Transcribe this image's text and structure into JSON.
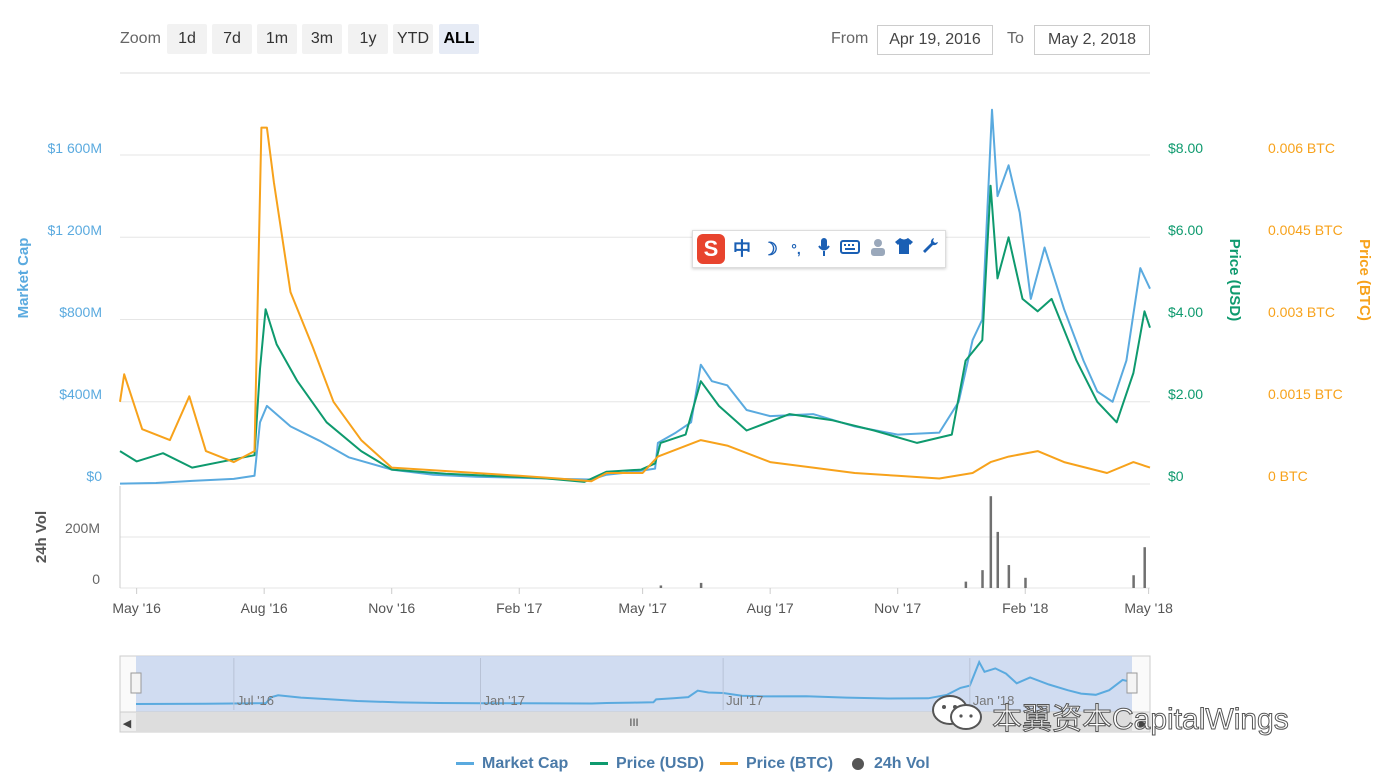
{
  "toolbar": {
    "zoom_label": "Zoom",
    "buttons": [
      "1d",
      "7d",
      "1m",
      "3m",
      "1y",
      "YTD",
      "ALL"
    ],
    "active": "ALL",
    "from_label": "From",
    "from_value": "Apr 19, 2016",
    "to_label": "To",
    "to_value": "May 2, 2018"
  },
  "colors": {
    "market_cap": "#5aaadf",
    "price_usd": "#0e9a6e",
    "price_btc": "#f7a21b",
    "volume": "#707070",
    "navigator_fill": "#c8d6ee"
  },
  "ime_toolbar": {
    "brand": "S",
    "items": [
      "中",
      "☽",
      "°,",
      "mic-icon",
      "keyboard-icon",
      "user-icon",
      "shirt-icon",
      "wrench-icon"
    ]
  },
  "watermark": {
    "text": "本翼资本CapitalWings"
  },
  "legend": {
    "items": [
      "Market Cap",
      "Price (USD)",
      "Price (BTC)",
      "24h Vol"
    ]
  },
  "chart_data": {
    "type": "line",
    "axes": {
      "market_cap": {
        "label": "Market Cap",
        "ticks": [
          "$0",
          "$400M",
          "$800M",
          "$1 200M",
          "$1 600M"
        ],
        "range": [
          0,
          1600
        ]
      },
      "price_usd": {
        "label": "Price (USD)",
        "ticks": [
          "$0",
          "$2.00",
          "$4.00",
          "$6.00",
          "$8.00"
        ],
        "range": [
          0,
          8
        ]
      },
      "price_btc": {
        "label": "Price (BTC)",
        "ticks": [
          "0 BTC",
          "0.0015 BTC",
          "0.003 BTC",
          "0.0045 BTC",
          "0.006 BTC"
        ],
        "range": [
          0,
          0.006
        ]
      },
      "volume": {
        "label": "24h Vol",
        "ticks": [
          "0",
          "200M"
        ],
        "range": [
          0,
          400
        ]
      }
    },
    "x_ticks": [
      "May '16",
      "Aug '16",
      "Nov '16",
      "Feb '17",
      "May '17",
      "Aug '17",
      "Nov '17",
      "Feb '18",
      "May '18"
    ],
    "navigator_ticks": [
      "Jul '16",
      "Jan '17",
      "Jul '17",
      "Jan '18"
    ],
    "x_range": [
      "2016-04-19",
      "2018-05-02"
    ],
    "series": [
      {
        "name": "Market Cap",
        "axis": "market_cap",
        "points": [
          [
            "2016-04-19",
            2
          ],
          [
            "2016-05-15",
            5
          ],
          [
            "2016-06-10",
            15
          ],
          [
            "2016-07-10",
            25
          ],
          [
            "2016-07-25",
            40
          ],
          [
            "2016-07-29",
            300
          ],
          [
            "2016-08-03",
            380
          ],
          [
            "2016-08-20",
            280
          ],
          [
            "2016-09-10",
            210
          ],
          [
            "2016-10-01",
            130
          ],
          [
            "2016-11-01",
            70
          ],
          [
            "2016-12-01",
            45
          ],
          [
            "2017-01-01",
            35
          ],
          [
            "2017-02-01",
            30
          ],
          [
            "2017-03-01",
            25
          ],
          [
            "2017-03-25",
            22
          ],
          [
            "2017-04-05",
            45
          ],
          [
            "2017-04-25",
            60
          ],
          [
            "2017-05-10",
            75
          ],
          [
            "2017-05-12",
            200
          ],
          [
            "2017-05-25",
            250
          ],
          [
            "2017-06-05",
            300
          ],
          [
            "2017-06-12",
            580
          ],
          [
            "2017-06-20",
            500
          ],
          [
            "2017-07-01",
            480
          ],
          [
            "2017-07-15",
            360
          ],
          [
            "2017-08-01",
            330
          ],
          [
            "2017-09-01",
            340
          ],
          [
            "2017-10-01",
            280
          ],
          [
            "2017-11-01",
            240
          ],
          [
            "2017-12-01",
            250
          ],
          [
            "2017-12-15",
            400
          ],
          [
            "2017-12-25",
            700
          ],
          [
            "2018-01-01",
            800
          ],
          [
            "2018-01-08",
            1820
          ],
          [
            "2018-01-12",
            1400
          ],
          [
            "2018-01-20",
            1550
          ],
          [
            "2018-01-28",
            1320
          ],
          [
            "2018-02-05",
            900
          ],
          [
            "2018-02-15",
            1150
          ],
          [
            "2018-03-01",
            850
          ],
          [
            "2018-03-15",
            600
          ],
          [
            "2018-03-25",
            450
          ],
          [
            "2018-04-05",
            400
          ],
          [
            "2018-04-15",
            600
          ],
          [
            "2018-04-25",
            1050
          ],
          [
            "2018-05-02",
            950
          ]
        ]
      },
      {
        "name": "Price (USD)",
        "axis": "price_usd",
        "points": [
          [
            "2016-04-19",
            0.8
          ],
          [
            "2016-05-01",
            0.55
          ],
          [
            "2016-05-20",
            0.75
          ],
          [
            "2016-06-10",
            0.4
          ],
          [
            "2016-07-10",
            0.6
          ],
          [
            "2016-07-25",
            0.7
          ],
          [
            "2016-07-29",
            2.8
          ],
          [
            "2016-08-02",
            4.25
          ],
          [
            "2016-08-10",
            3.4
          ],
          [
            "2016-08-25",
            2.5
          ],
          [
            "2016-09-15",
            1.5
          ],
          [
            "2016-10-10",
            0.8
          ],
          [
            "2016-11-01",
            0.35
          ],
          [
            "2016-12-10",
            0.25
          ],
          [
            "2017-01-10",
            0.2
          ],
          [
            "2017-02-15",
            0.15
          ],
          [
            "2017-03-20",
            0.05
          ],
          [
            "2017-04-05",
            0.3
          ],
          [
            "2017-04-30",
            0.35
          ],
          [
            "2017-05-10",
            0.5
          ],
          [
            "2017-05-14",
            1.0
          ],
          [
            "2017-06-01",
            1.2
          ],
          [
            "2017-06-12",
            2.5
          ],
          [
            "2017-06-25",
            1.9
          ],
          [
            "2017-07-15",
            1.3
          ],
          [
            "2017-08-15",
            1.7
          ],
          [
            "2017-09-15",
            1.55
          ],
          [
            "2017-10-15",
            1.3
          ],
          [
            "2017-11-15",
            1.0
          ],
          [
            "2017-12-10",
            1.2
          ],
          [
            "2017-12-20",
            3.0
          ],
          [
            "2018-01-01",
            3.5
          ],
          [
            "2018-01-07",
            7.25
          ],
          [
            "2018-01-12",
            5.0
          ],
          [
            "2018-01-20",
            6.0
          ],
          [
            "2018-01-30",
            4.5
          ],
          [
            "2018-02-10",
            4.2
          ],
          [
            "2018-02-20",
            4.5
          ],
          [
            "2018-03-10",
            3.0
          ],
          [
            "2018-03-25",
            2.0
          ],
          [
            "2018-04-08",
            1.5
          ],
          [
            "2018-04-20",
            2.7
          ],
          [
            "2018-04-28",
            4.2
          ],
          [
            "2018-05-02",
            3.8
          ]
        ]
      },
      {
        "name": "Price (BTC)",
        "axis": "price_btc",
        "points": [
          [
            "2016-04-19",
            0.0015
          ],
          [
            "2016-04-22",
            0.002
          ],
          [
            "2016-05-05",
            0.001
          ],
          [
            "2016-05-25",
            0.0008
          ],
          [
            "2016-06-08",
            0.0016
          ],
          [
            "2016-06-20",
            0.0006
          ],
          [
            "2016-07-10",
            0.0004
          ],
          [
            "2016-07-25",
            0.0006
          ],
          [
            "2016-07-30",
            0.0065
          ],
          [
            "2016-08-03",
            0.0065
          ],
          [
            "2016-08-08",
            0.0055
          ],
          [
            "2016-08-20",
            0.0035
          ],
          [
            "2016-09-05",
            0.0025
          ],
          [
            "2016-09-20",
            0.0015
          ],
          [
            "2016-10-10",
            0.0008
          ],
          [
            "2016-11-01",
            0.0003
          ],
          [
            "2016-12-01",
            0.00025
          ],
          [
            "2017-01-01",
            0.0002
          ],
          [
            "2017-02-01",
            0.00015
          ],
          [
            "2017-03-01",
            0.0001
          ],
          [
            "2017-03-25",
            5e-05
          ],
          [
            "2017-04-05",
            0.0002
          ],
          [
            "2017-05-01",
            0.0002
          ],
          [
            "2017-05-12",
            0.0005
          ],
          [
            "2017-06-12",
            0.0008
          ],
          [
            "2017-07-01",
            0.0007
          ],
          [
            "2017-08-01",
            0.0004
          ],
          [
            "2017-09-01",
            0.0003
          ],
          [
            "2017-10-01",
            0.0002
          ],
          [
            "2017-11-01",
            0.00015
          ],
          [
            "2017-12-01",
            0.0001
          ],
          [
            "2017-12-25",
            0.0002
          ],
          [
            "2018-01-07",
            0.0004
          ],
          [
            "2018-01-20",
            0.0005
          ],
          [
            "2018-02-10",
            0.0006
          ],
          [
            "2018-03-01",
            0.0004
          ],
          [
            "2018-04-01",
            0.0002
          ],
          [
            "2018-04-20",
            0.0004
          ],
          [
            "2018-05-02",
            0.0003
          ]
        ]
      },
      {
        "name": "24h Vol",
        "axis": "volume",
        "points": [
          [
            "2017-05-14",
            10
          ],
          [
            "2017-06-12",
            20
          ],
          [
            "2017-12-20",
            25
          ],
          [
            "2018-01-01",
            70
          ],
          [
            "2018-01-07",
            360
          ],
          [
            "2018-01-12",
            220
          ],
          [
            "2018-01-20",
            90
          ],
          [
            "2018-02-01",
            40
          ],
          [
            "2018-04-20",
            50
          ],
          [
            "2018-04-28",
            160
          ]
        ]
      }
    ]
  }
}
